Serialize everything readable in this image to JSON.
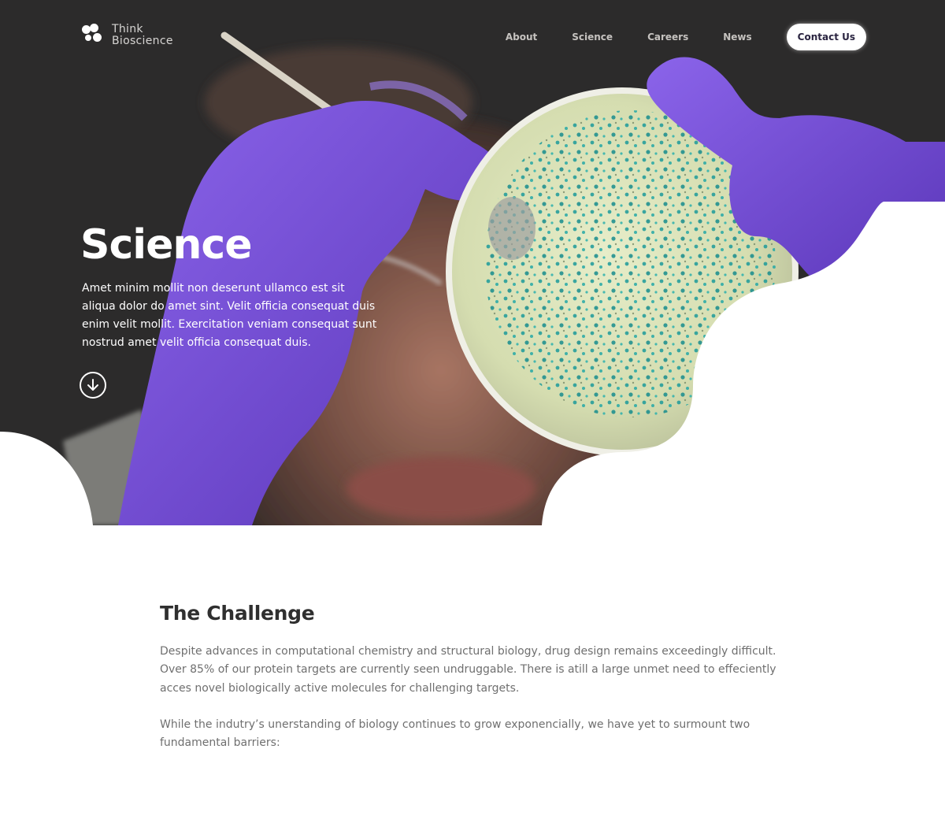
{
  "brand": {
    "line1": "Think",
    "line2": "Bioscience"
  },
  "nav": {
    "links": [
      "About",
      "Science",
      "Careers",
      "News"
    ],
    "cta": "Contact Us"
  },
  "hero": {
    "title": "Science",
    "description": "Amet minim mollit non deserunt ullamco est sit aliqua dolor do amet sint. Velit officia consequat duis enim velit mollit. Exercitation veniam consequat sunt nostrud amet velit officia consequat duis.",
    "scroll_icon": "arrow-down-circle-icon"
  },
  "challenge": {
    "title": "The Challenge",
    "paragraph1": "Despite advances in computational chemistry and structural biology, drug design remains exceedingly difficult. Over 85% of our protein targets are currently seen undruggable. There is atill a large unmet need to effeciently acces novel biologically active molecules for challenging targets.",
    "paragraph2": "While the indutry’s unerstanding of biology continues to grow exponencially, we have yet to surmount two fundamental barriers:"
  },
  "colors": {
    "glove_purple": "#7b55d9",
    "petri_fill": "#dfe6bd",
    "colony_teal": "#1c9a9a",
    "heading": "#2f2f2f",
    "body_text": "#6f6f6f"
  }
}
